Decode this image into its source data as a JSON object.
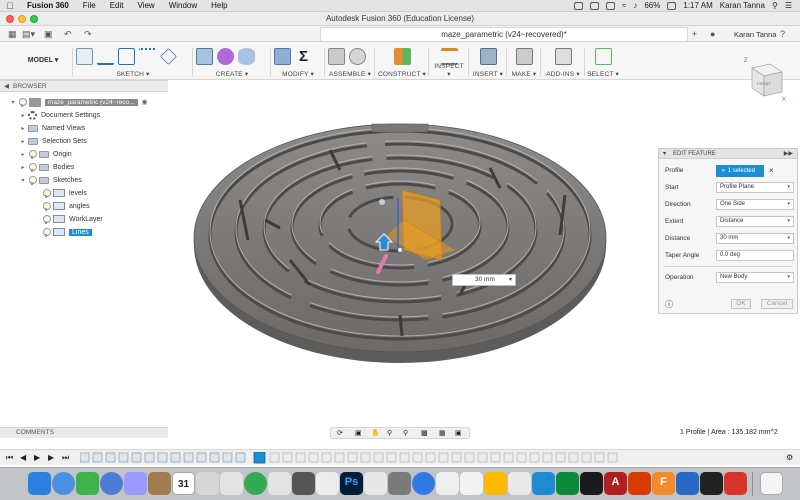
{
  "menubar": {
    "app_name": "Fusion 360",
    "items": [
      "File",
      "Edit",
      "View",
      "Window",
      "Help"
    ],
    "battery": "66%",
    "time": "1:17 AM",
    "user": "Karan Tanna"
  },
  "window": {
    "title": "Autodesk Fusion 360 (Education License)"
  },
  "tabs": {
    "doc_tab": "maze_parametric (v24~recovered)*",
    "user": "Karan Tanna"
  },
  "ribbon": {
    "workspace": "MODEL",
    "groups": [
      "SKETCH",
      "CREATE",
      "MODIFY",
      "ASSEMBLE",
      "CONSTRUCT",
      "INSPECT",
      "INSERT",
      "MAKE",
      "ADD-INS",
      "SELECT"
    ]
  },
  "browser": {
    "header": "BROWSER",
    "root": "maze_parametric (v24~reco...",
    "items": [
      "Document Settings",
      "Named Views",
      "Selection Sets",
      "Origin",
      "Bodies",
      "Sketches"
    ],
    "sketches": [
      "levels",
      "angles",
      "WorkLayer",
      "Lines"
    ]
  },
  "viewcube": {
    "face": "FRONT",
    "axis_z": "Z",
    "axis_x": "X"
  },
  "dimension_input": {
    "value": "30 mm"
  },
  "edit_feature": {
    "title": "EDIT FEATURE",
    "profile_label": "Profile",
    "profile_value": "1 selected",
    "start_label": "Start",
    "start_value": "Profile Plane",
    "direction_label": "Direction",
    "direction_value": "One Side",
    "extent_label": "Extent",
    "extent_value": "Distance",
    "distance_label": "Distance",
    "distance_value": "30 mm",
    "taper_label": "Taper Angle",
    "taper_value": "0.0 deg",
    "operation_label": "Operation",
    "operation_value": "New Body",
    "ok_label": "OK",
    "cancel_label": "Cancel"
  },
  "comments": {
    "label": "COMMENTS"
  },
  "status": {
    "text": "1 Profile | Area : 135.182 mm^2"
  },
  "dock": {
    "calendar_day": "31"
  },
  "colors": {
    "accent_blue": "#1c8ed8",
    "model_gray": "#7e7c7a",
    "sketch_orange": "#f0a020"
  }
}
